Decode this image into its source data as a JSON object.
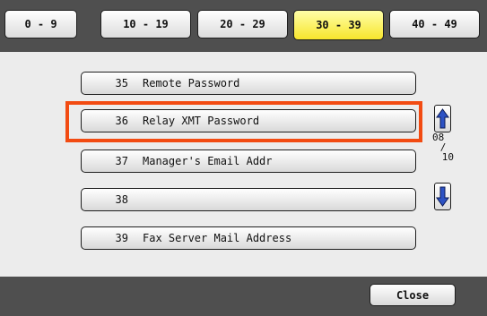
{
  "tabs": [
    {
      "label": "0 - 9",
      "active": false
    },
    {
      "label": "10 - 19",
      "active": false
    },
    {
      "label": "20 - 29",
      "active": false
    },
    {
      "label": "30 - 39",
      "active": true
    },
    {
      "label": "40 - 49",
      "active": false
    }
  ],
  "rows": [
    {
      "num": "35",
      "label": "Remote Password"
    },
    {
      "num": "36",
      "label": "Relay XMT Password",
      "highlighted": true
    },
    {
      "num": "37",
      "label": "Manager's Email Addr"
    },
    {
      "num": "38",
      "label": ""
    },
    {
      "num": "39",
      "label": "Fax Server Mail Address"
    }
  ],
  "pager": {
    "current": "08",
    "separator": "/",
    "total": "10"
  },
  "footer": {
    "close_label": "Close"
  },
  "colors": {
    "active_tab": "#f7e52c",
    "highlight": "#f24b12",
    "bar": "#4f4f4f"
  },
  "icons": {
    "up": "arrow-up-icon",
    "down": "arrow-down-icon"
  }
}
